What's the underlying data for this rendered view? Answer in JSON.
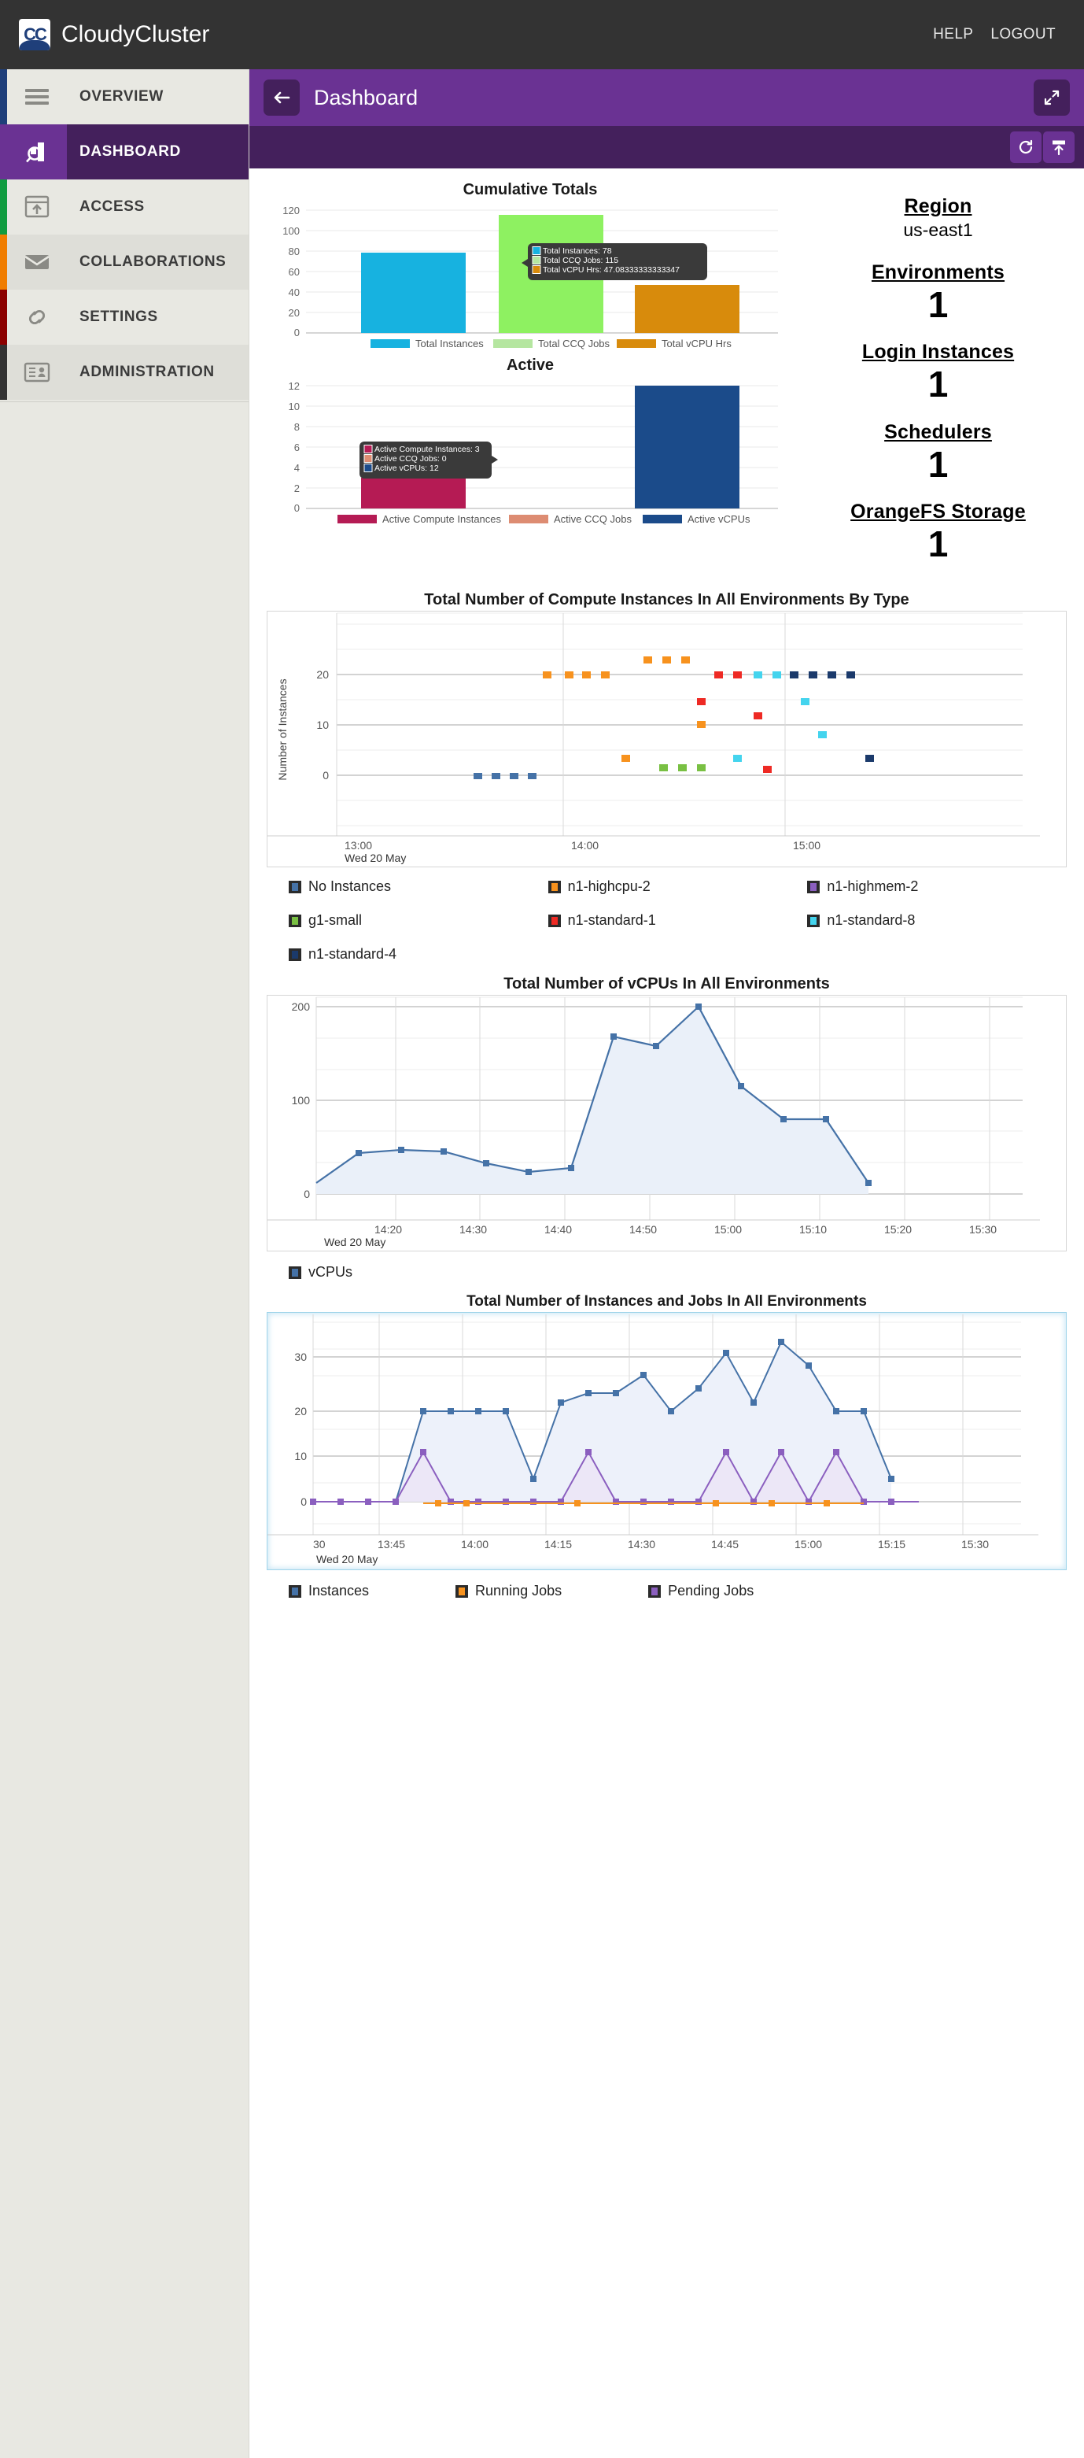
{
  "topbar": {
    "brand": "CloudyCluster",
    "logo_text": "CC",
    "help": "HELP",
    "logout": "LOGOUT"
  },
  "sidebar": {
    "items": [
      {
        "label": "OVERVIEW",
        "icon": "hamburger-icon",
        "accent": "#1f3f7a",
        "state": "normal"
      },
      {
        "label": "DASHBOARD",
        "icon": "analytics-icon",
        "accent": "#6a3293",
        "state": "active"
      },
      {
        "label": "ACCESS",
        "icon": "upload-window-icon",
        "accent": "#109c40",
        "state": "normal"
      },
      {
        "label": "COLLABORATIONS",
        "icon": "envelope-icon",
        "accent": "#f07d00",
        "state": "alt"
      },
      {
        "label": "SETTINGS",
        "icon": "link-icon",
        "accent": "#8b0000",
        "state": "normal"
      },
      {
        "label": "ADMINISTRATION",
        "icon": "id-card-icon",
        "accent": "#333333",
        "state": "alt"
      }
    ]
  },
  "page": {
    "title": "Dashboard",
    "back_icon": "back-arrow-icon",
    "expand_icon": "expand-arrows-icon",
    "refresh_icon": "refresh-icon",
    "export_icon": "export-upload-icon"
  },
  "stats": {
    "region_label": "Region",
    "region_value": "us-east1",
    "blocks": [
      {
        "label": "Environments",
        "value": "1"
      },
      {
        "label": "Login Instances",
        "value": "1"
      },
      {
        "label": "Schedulers",
        "value": "1"
      },
      {
        "label": "OrangeFS Storage",
        "value": "1"
      }
    ]
  },
  "tooltips": {
    "cumulative": [
      {
        "label": "Total Instances: 78",
        "color": "#17b2e0"
      },
      {
        "label": "Total CCQ Jobs: 115",
        "color": "#b5e6a0"
      },
      {
        "label": "Total vCPU Hrs: 47.08333333333347",
        "color": "#d88b0c"
      }
    ],
    "active": [
      {
        "label": "Active Compute Instances: 3",
        "color": "#b51b54"
      },
      {
        "label": "Active CCQ Jobs: 0",
        "color": "#dd8c72"
      },
      {
        "label": "Active vCPUs: 12",
        "color": "#1b4b8a"
      }
    ]
  },
  "chart_data": [
    {
      "type": "bar",
      "title": "Cumulative Totals",
      "categories": [
        "Total Instances",
        "Total CCQ Jobs",
        "Total vCPU Hrs"
      ],
      "values": [
        78,
        115,
        47.08333333333347
      ],
      "colors": [
        "#17b2e0",
        "#8ef161",
        "#d88b0c"
      ],
      "legend_colors": [
        "#17b2e0",
        "#b5e6a0",
        "#d88b0c"
      ],
      "ylim": [
        0,
        120
      ],
      "yticks": [
        0,
        20,
        40,
        60,
        80,
        100,
        120
      ],
      "xlabel": "",
      "ylabel": "",
      "grid": true,
      "legend": "bottom"
    },
    {
      "type": "bar",
      "title": "Active",
      "categories": [
        "Active Compute Instances",
        "Active CCQ Jobs",
        "Active vCPUs"
      ],
      "values": [
        3,
        0,
        12
      ],
      "colors": [
        "#b51b54",
        "#dd8c72",
        "#1b4b8a"
      ],
      "legend_colors": [
        "#b51b54",
        "#dd8c72",
        "#1b4b8a"
      ],
      "ylim": [
        0,
        12
      ],
      "yticks": [
        0,
        2,
        4,
        6,
        8,
        10,
        12
      ],
      "xlabel": "",
      "ylabel": "",
      "grid": true,
      "legend": "bottom"
    },
    {
      "type": "scatter",
      "title": "Total Number of Compute Instances In All Environments By Type",
      "xlabel": "Wed 20 May",
      "ylabel": "Number of Instances",
      "xticks": [
        "13:00",
        "14:00",
        "15:00"
      ],
      "yticks": [
        0,
        10,
        20
      ],
      "ylim": [
        -4,
        25
      ],
      "xlim": [
        "12:45",
        "15:25"
      ],
      "grid": true,
      "legend": "below",
      "series": [
        {
          "name": "No Instances",
          "color": "#4572a7",
          "points": [
            [
              "13:30",
              0
            ],
            [
              "13:36",
              0
            ],
            [
              "13:42",
              0
            ],
            [
              "13:48",
              0
            ]
          ]
        },
        {
          "name": "n1-highcpu-2",
          "color": "#f7921e",
          "points": [
            [
              "13:55",
              20
            ],
            [
              "14:00",
              20
            ],
            [
              "14:04",
              20
            ],
            [
              "14:09",
              20
            ],
            [
              "14:12",
              23
            ],
            [
              "14:15",
              23
            ],
            [
              "14:18",
              23
            ],
            [
              "14:18",
              10
            ],
            [
              "14:06",
              5
            ]
          ]
        },
        {
          "name": "n1-highmem-2",
          "color": "#8b5fbf",
          "points": []
        },
        {
          "name": "g1-small",
          "color": "#79c043",
          "points": [
            [
              "14:14",
              1
            ],
            [
              "14:17",
              1
            ],
            [
              "14:20",
              1
            ]
          ]
        },
        {
          "name": "n1-standard-1",
          "color": "#ee2a24",
          "points": [
            [
              "14:24",
              20
            ],
            [
              "14:27",
              20
            ],
            [
              "14:18",
              16
            ],
            [
              "14:30",
              13
            ],
            [
              "14:33",
              2
            ]
          ]
        },
        {
          "name": "n1-standard-8",
          "color": "#44d4ee",
          "points": [
            [
              "14:31",
              20
            ],
            [
              "14:35",
              20
            ],
            [
              "14:28",
              5
            ],
            [
              "14:43",
              16
            ],
            [
              "14:47",
              9
            ]
          ]
        },
        {
          "name": "n1-standard-4",
          "color": "#1b3a6b",
          "points": [
            [
              "14:39",
              20
            ],
            [
              "14:43",
              20
            ],
            [
              "14:48",
              20
            ],
            [
              "14:52",
              20
            ],
            [
              "15:05",
              5
            ]
          ]
        }
      ],
      "legend_entries": [
        {
          "name": "No Instances",
          "color": "#4572a7"
        },
        {
          "name": "n1-highcpu-2",
          "color": "#f7921e"
        },
        {
          "name": "n1-highmem-2",
          "color": "#8b5fbf"
        },
        {
          "name": "g1-small",
          "color": "#79c043"
        },
        {
          "name": "n1-standard-1",
          "color": "#ee2a24"
        },
        {
          "name": "n1-standard-8",
          "color": "#44d4ee"
        },
        {
          "name": "n1-standard-4",
          "color": "#1b3a6b"
        }
      ]
    },
    {
      "type": "area",
      "title": "Total Number of vCPUs In All Environments",
      "xlabel": "Wed 20 May",
      "ylabel": "",
      "xticks": [
        "14:20",
        "14:30",
        "14:40",
        "14:50",
        "15:00",
        "15:10",
        "15:20",
        "15:30"
      ],
      "yticks": [
        0,
        100,
        200
      ],
      "ylim": [
        0,
        215
      ],
      "grid": true,
      "legend": "below",
      "legend_entries": [
        {
          "name": "vCPUs",
          "color": "#4572a7"
        }
      ],
      "series": [
        {
          "name": "vCPUs",
          "color": "#4572a7",
          "x": [
            "14:15",
            "14:20",
            "14:25",
            "14:30",
            "14:35",
            "14:40",
            "14:45",
            "14:50",
            "14:55",
            "15:00",
            "15:05",
            "15:10",
            "15:15",
            "15:20"
          ],
          "values": [
            12,
            44,
            48,
            46,
            33,
            24,
            28,
            168,
            158,
            200,
            115,
            80,
            80,
            12
          ]
        }
      ]
    },
    {
      "type": "area",
      "title": "Total Number of Instances and Jobs In All Environments",
      "xlabel": "Wed 20 May",
      "ylabel": "",
      "xticks": [
        "30",
        "13:45",
        "14:00",
        "14:15",
        "14:30",
        "14:45",
        "15:00",
        "15:15",
        "15:30"
      ],
      "yticks": [
        0,
        10,
        20,
        30
      ],
      "ylim": [
        -4,
        38
      ],
      "grid": true,
      "legend": "below",
      "legend_entries": [
        {
          "name": "Instances",
          "color": "#4572a7"
        },
        {
          "name": "Running Jobs",
          "color": "#f7921e"
        },
        {
          "name": "Pending Jobs",
          "color": "#8b5fbf"
        }
      ],
      "series": [
        {
          "name": "Instances",
          "color": "#4572a7",
          "x": [
            "13:30",
            "13:35",
            "13:40",
            "13:45",
            "13:50",
            "13:55",
            "14:00",
            "14:05",
            "14:10",
            "14:15",
            "14:20",
            "14:25",
            "14:30",
            "14:35",
            "14:40",
            "14:45",
            "14:50",
            "14:55",
            "15:00",
            "15:05",
            "15:10",
            "15:15",
            "15:20"
          ],
          "values": [
            0,
            0,
            0,
            0,
            20,
            20,
            20,
            20,
            5,
            22,
            24,
            24,
            28,
            20,
            25,
            33,
            22,
            36,
            29,
            20,
            20,
            5,
            null
          ]
        },
        {
          "name": "Running Jobs",
          "color": "#f7921e",
          "x": [
            "13:50",
            "14:00",
            "14:20",
            "14:45",
            "15:00",
            "15:10"
          ],
          "values": [
            0,
            0,
            0,
            0,
            0,
            0
          ]
        },
        {
          "name": "Pending Jobs",
          "color": "#8b5fbf",
          "x": [
            "13:30",
            "13:35",
            "13:40",
            "13:45",
            "13:50",
            "13:55",
            "14:00",
            "14:05",
            "14:10",
            "14:15",
            "14:20",
            "14:25",
            "14:30",
            "14:35",
            "14:40",
            "14:45",
            "14:50",
            "14:55",
            "15:00",
            "15:05",
            "15:10",
            "15:15",
            "15:20"
          ],
          "values": [
            0,
            0,
            0,
            0,
            11,
            0,
            0,
            0,
            0,
            0,
            11,
            0,
            0,
            0,
            0,
            11,
            0,
            11,
            0,
            11,
            0,
            0,
            0
          ]
        }
      ]
    }
  ]
}
